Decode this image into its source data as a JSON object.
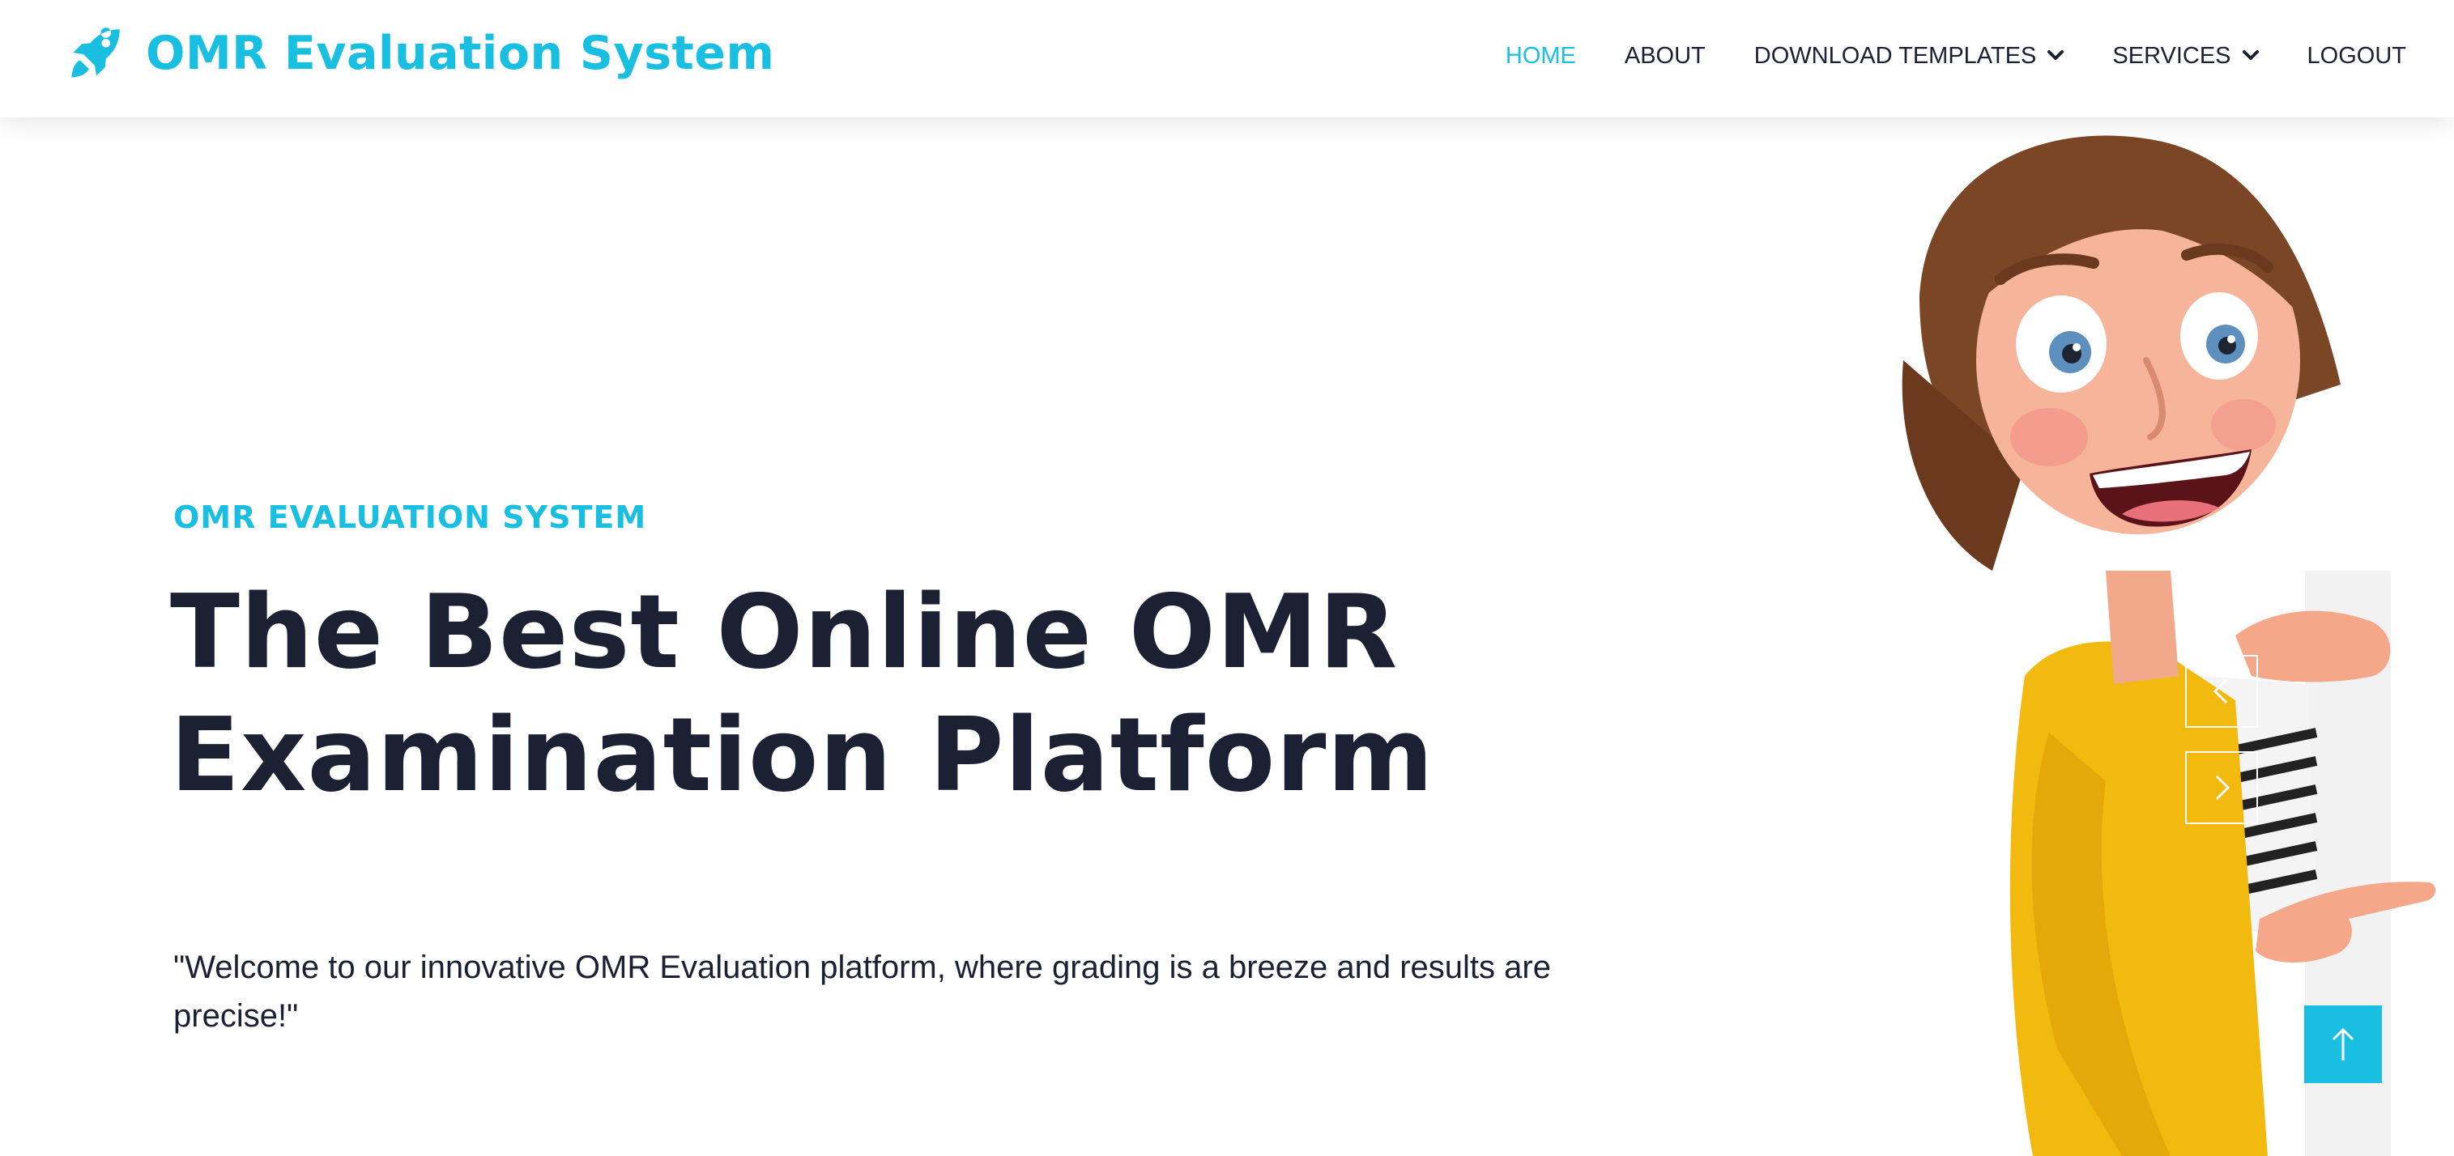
{
  "brand": {
    "title": "OMR Evaluation System",
    "icon": "rocket-icon"
  },
  "nav": {
    "items": [
      {
        "label": "HOME",
        "active": true,
        "dropdown": false
      },
      {
        "label": "ABOUT",
        "active": false,
        "dropdown": false
      },
      {
        "label": "DOWNLOAD TEMPLATES",
        "active": false,
        "dropdown": true
      },
      {
        "label": "SERVICES",
        "active": false,
        "dropdown": true
      },
      {
        "label": "LOGOUT",
        "active": false,
        "dropdown": false
      }
    ]
  },
  "hero": {
    "eyebrow": "OMR EVALUATION SYSTEM",
    "title_line1": "The Best Online OMR",
    "title_line2": "Examination Platform",
    "subtitle": "\"Welcome to our innovative OMR Evaluation platform, where grading is a breeze and results are precise!\""
  },
  "carousel": {
    "prev_icon": "chevron-left-icon",
    "next_icon": "chevron-right-icon"
  },
  "back_to_top": {
    "icon": "arrow-up-icon"
  },
  "colors": {
    "accent": "#19bfe0",
    "text_dark": "#1b2033",
    "background": "#ffffff"
  }
}
